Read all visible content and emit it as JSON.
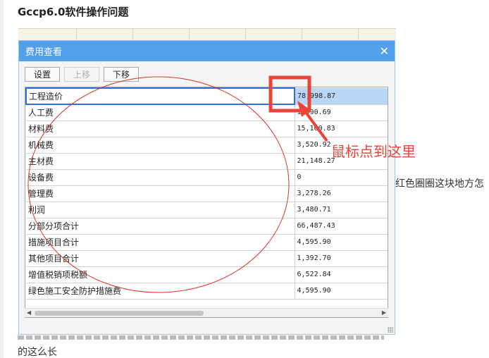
{
  "page": {
    "title": "Gccp6.0软件操作问题",
    "side_note": "红色圈圈这块地方怎",
    "bottom_line2": "的这么长"
  },
  "dialog": {
    "title": "费用查看",
    "close_glyph": "✕",
    "toolbar": {
      "settings": "设置",
      "move_up": "上移",
      "move_down": "下移"
    },
    "rows": [
      {
        "name": "工程造价",
        "value": "78,998.87",
        "selected": true
      },
      {
        "name": "人工费",
        "value": "1,590.69"
      },
      {
        "name": "材料费",
        "value": "15,160.83"
      },
      {
        "name": "机械费",
        "value": "3,520.92"
      },
      {
        "name": "主材费",
        "value": "21,148.27"
      },
      {
        "name": "设备费",
        "value": "0"
      },
      {
        "name": "管理费",
        "value": "3,278.26"
      },
      {
        "name": "利润",
        "value": "3,480.71"
      },
      {
        "name": "分部分项合计",
        "value": "66,487.43"
      },
      {
        "name": "措施项目合计",
        "value": "4,595.90"
      },
      {
        "name": "其他项目合计",
        "value": "1,392.70"
      },
      {
        "name": "增值税销项税额",
        "value": "6,522.84"
      },
      {
        "name": "绿色施工安全防护措施费",
        "value": "4,595.90"
      }
    ]
  },
  "annotation": {
    "callout_text": "鼠标点到这里",
    "color": "#e8443a"
  }
}
